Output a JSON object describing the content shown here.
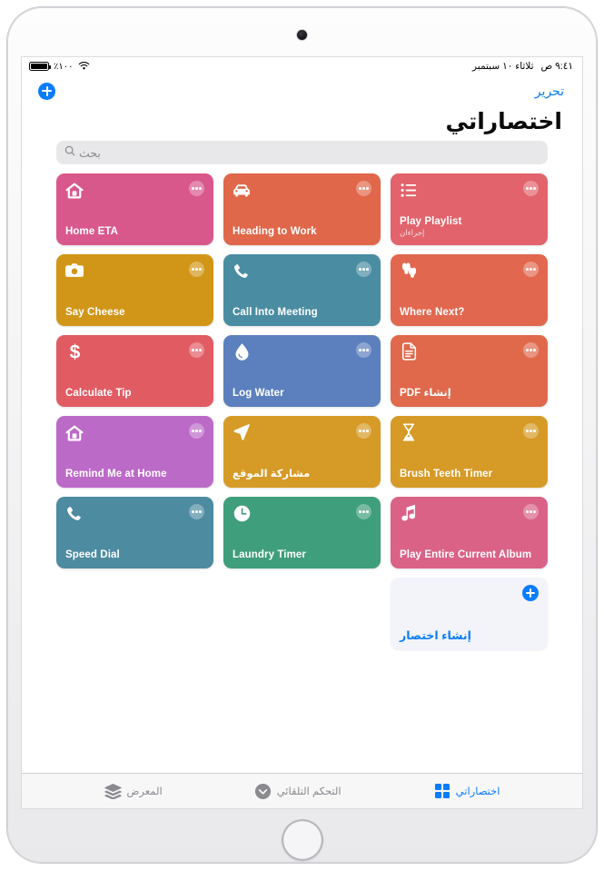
{
  "statusbar": {
    "battery_percent": "٪١٠٠",
    "time": "٩:٤١ ص",
    "date": "ثلاثاء ١٠ سبتمبر",
    "wifi_icon": "wifi-icon",
    "battery_icon": "battery-icon"
  },
  "nav": {
    "edit_label": "تحرير",
    "add_icon": "plus-icon"
  },
  "header": {
    "title": "اختصاراتي"
  },
  "search": {
    "placeholder": "بحث",
    "icon": "search-icon"
  },
  "shortcuts": [
    {
      "title": "Play Playlist",
      "subtitle": "إجراءان",
      "color": "#e2636b",
      "icon": "list-icon",
      "rtl": false
    },
    {
      "title": "Heading to Work",
      "subtitle": "",
      "color": "#e0674a",
      "icon": "car-icon",
      "rtl": false
    },
    {
      "title": "Home ETA",
      "subtitle": "",
      "color": "#d9588c",
      "icon": "house-icon",
      "rtl": false
    },
    {
      "title": "Where Next?",
      "subtitle": "",
      "color": "#e2674f",
      "icon": "footsteps-icon",
      "rtl": false
    },
    {
      "title": "Call Into Meeting",
      "subtitle": "",
      "color": "#4a8da3",
      "icon": "phone-icon",
      "rtl": false
    },
    {
      "title": "Say Cheese",
      "subtitle": "",
      "color": "#d19617",
      "icon": "camera-icon",
      "rtl": false
    },
    {
      "title": "إنشاء PDF",
      "subtitle": "",
      "color": "#e0694c",
      "icon": "document-icon",
      "rtl": true
    },
    {
      "title": "Log Water",
      "subtitle": "",
      "color": "#5b80bd",
      "icon": "droplet-icon",
      "rtl": false
    },
    {
      "title": "Calculate Tip",
      "subtitle": "",
      "color": "#e15b63",
      "icon": "dollar-icon",
      "rtl": false
    },
    {
      "title": "Brush Teeth Timer",
      "subtitle": "",
      "color": "#d69a26",
      "icon": "hourglass-icon",
      "rtl": false
    },
    {
      "title": "مشاركة الموقع",
      "subtitle": "",
      "color": "#d69a26",
      "icon": "location-arrow-icon",
      "rtl": true
    },
    {
      "title": "Remind Me at Home",
      "subtitle": "",
      "color": "#bc6ac8",
      "icon": "house-icon",
      "rtl": false
    },
    {
      "title": "Play Entire Current Album",
      "subtitle": "",
      "color": "#da6287",
      "icon": "music-note-icon",
      "rtl": false
    },
    {
      "title": "Laundry Timer",
      "subtitle": "",
      "color": "#3f9e7c",
      "icon": "clock-icon",
      "rtl": false
    },
    {
      "title": "Speed Dial",
      "subtitle": "",
      "color": "#4d8ba1",
      "icon": "phone-icon",
      "rtl": false
    }
  ],
  "create_card": {
    "label": "إنشاء اختصار",
    "icon": "plus-icon"
  },
  "tabs": [
    {
      "label": "اختصاراتي",
      "icon": "grid-icon",
      "active": true
    },
    {
      "label": "التحكم التلقائي",
      "icon": "automation-icon",
      "active": false
    },
    {
      "label": "المعرض",
      "icon": "layers-icon",
      "active": false
    }
  ],
  "colors": {
    "accent": "#0a7cff",
    "search_bg": "#e8e8ea",
    "tabbar_bg": "#f7f7f8",
    "inactive_tab": "#8a8a8f"
  }
}
